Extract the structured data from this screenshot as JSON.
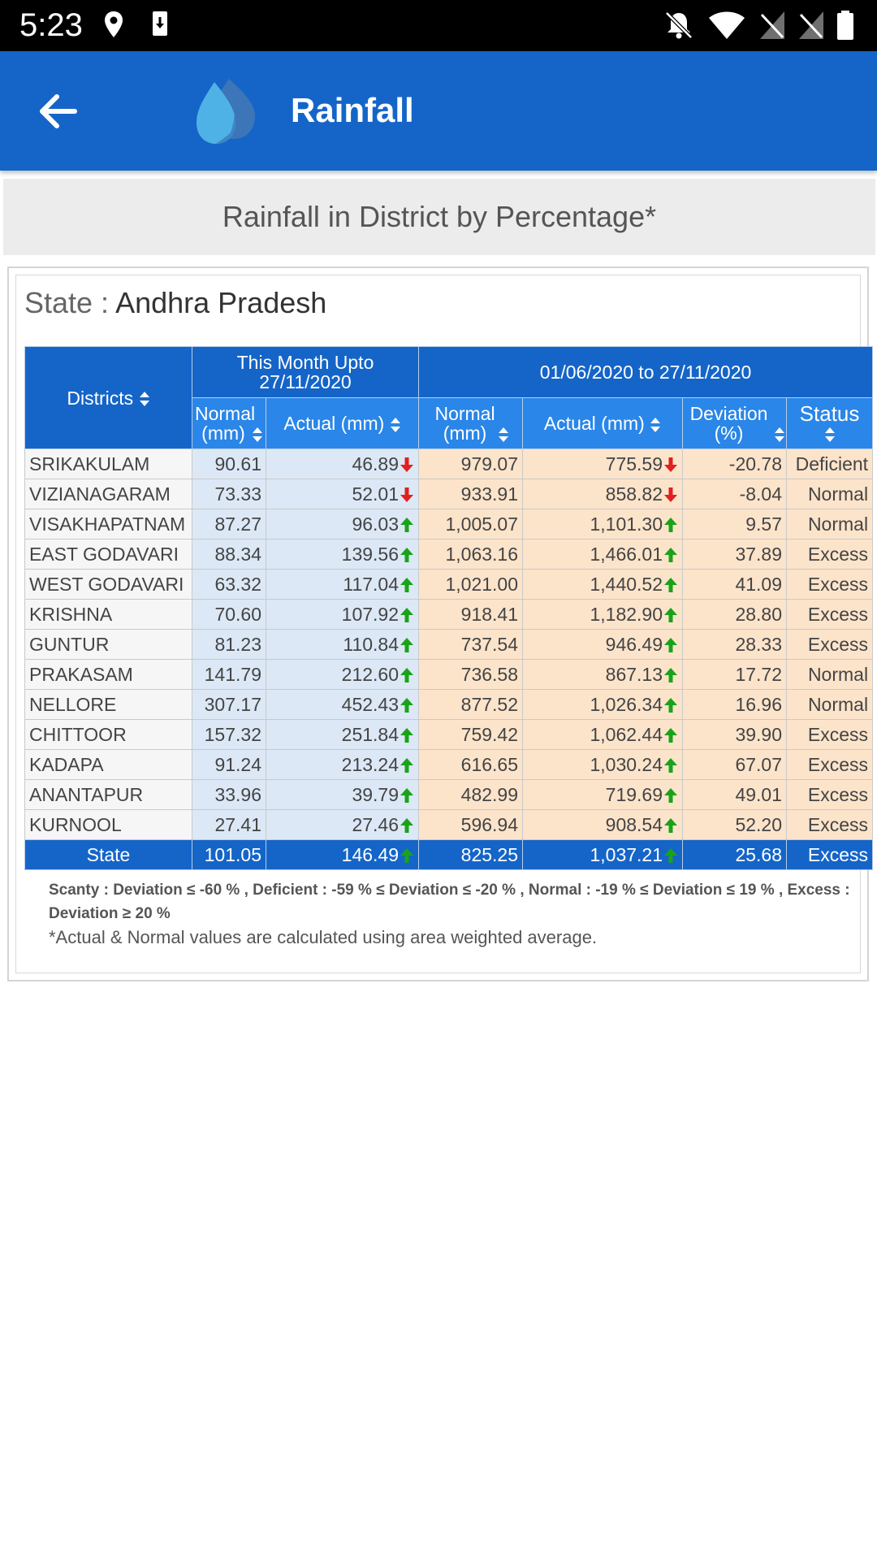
{
  "status_bar": {
    "time": "5:23"
  },
  "app_bar": {
    "title": "Rainfall"
  },
  "subheader": "Rainfall in District by Percentage*",
  "state": {
    "label": "State :",
    "value": "Andhra Pradesh"
  },
  "table": {
    "headers": {
      "districts": "Districts",
      "this_month": "This Month Upto 27/11/2020",
      "period": "01/06/2020 to 27/11/2020",
      "normal_mm": "Normal (mm)",
      "actual_mm": "Actual (mm)",
      "deviation": "Deviation (%)",
      "status": "Status"
    },
    "rows": [
      {
        "district": "SRIKAKULAM",
        "m_normal": "90.61",
        "m_actual": "46.89",
        "m_trend": "down",
        "p_normal": "979.07",
        "p_actual": "775.59",
        "p_trend": "down",
        "deviation": "-20.78",
        "status": "Deficient"
      },
      {
        "district": "VIZIANAGARAM",
        "m_normal": "73.33",
        "m_actual": "52.01",
        "m_trend": "down",
        "p_normal": "933.91",
        "p_actual": "858.82",
        "p_trend": "down",
        "deviation": "-8.04",
        "status": "Normal"
      },
      {
        "district": "VISAKHAPATNAM",
        "m_normal": "87.27",
        "m_actual": "96.03",
        "m_trend": "up",
        "p_normal": "1,005.07",
        "p_actual": "1,101.30",
        "p_trend": "up",
        "deviation": "9.57",
        "status": "Normal"
      },
      {
        "district": "EAST GODAVARI",
        "m_normal": "88.34",
        "m_actual": "139.56",
        "m_trend": "up",
        "p_normal": "1,063.16",
        "p_actual": "1,466.01",
        "p_trend": "up",
        "deviation": "37.89",
        "status": "Excess"
      },
      {
        "district": "WEST GODAVARI",
        "m_normal": "63.32",
        "m_actual": "117.04",
        "m_trend": "up",
        "p_normal": "1,021.00",
        "p_actual": "1,440.52",
        "p_trend": "up",
        "deviation": "41.09",
        "status": "Excess"
      },
      {
        "district": "KRISHNA",
        "m_normal": "70.60",
        "m_actual": "107.92",
        "m_trend": "up",
        "p_normal": "918.41",
        "p_actual": "1,182.90",
        "p_trend": "up",
        "deviation": "28.80",
        "status": "Excess"
      },
      {
        "district": "GUNTUR",
        "m_normal": "81.23",
        "m_actual": "110.84",
        "m_trend": "up",
        "p_normal": "737.54",
        "p_actual": "946.49",
        "p_trend": "up",
        "deviation": "28.33",
        "status": "Excess"
      },
      {
        "district": "PRAKASAM",
        "m_normal": "141.79",
        "m_actual": "212.60",
        "m_trend": "up",
        "p_normal": "736.58",
        "p_actual": "867.13",
        "p_trend": "up",
        "deviation": "17.72",
        "status": "Normal"
      },
      {
        "district": "NELLORE",
        "m_normal": "307.17",
        "m_actual": "452.43",
        "m_trend": "up",
        "p_normal": "877.52",
        "p_actual": "1,026.34",
        "p_trend": "up",
        "deviation": "16.96",
        "status": "Normal"
      },
      {
        "district": "CHITTOOR",
        "m_normal": "157.32",
        "m_actual": "251.84",
        "m_trend": "up",
        "p_normal": "759.42",
        "p_actual": "1,062.44",
        "p_trend": "up",
        "deviation": "39.90",
        "status": "Excess"
      },
      {
        "district": "KADAPA",
        "m_normal": "91.24",
        "m_actual": "213.24",
        "m_trend": "up",
        "p_normal": "616.65",
        "p_actual": "1,030.24",
        "p_trend": "up",
        "deviation": "67.07",
        "status": "Excess"
      },
      {
        "district": "ANANTAPUR",
        "m_normal": "33.96",
        "m_actual": "39.79",
        "m_trend": "up",
        "p_normal": "482.99",
        "p_actual": "719.69",
        "p_trend": "up",
        "deviation": "49.01",
        "status": "Excess"
      },
      {
        "district": "KURNOOL",
        "m_normal": "27.41",
        "m_actual": "27.46",
        "m_trend": "up",
        "p_normal": "596.94",
        "p_actual": "908.54",
        "p_trend": "up",
        "deviation": "52.20",
        "status": "Excess"
      }
    ],
    "total": {
      "district": "State",
      "m_normal": "101.05",
      "m_actual": "146.49",
      "m_trend": "up",
      "p_normal": "825.25",
      "p_actual": "1,037.21",
      "p_trend": "up",
      "deviation": "25.68",
      "status": "Excess"
    }
  },
  "legend": "Scanty : Deviation ≤ -60 % ,    Deficient : -59 % ≤ Deviation ≤ -20 % ,    Normal : -19 % ≤ Deviation ≤ 19 % ,    Excess : Deviation ≥ 20 %",
  "note": "*Actual & Normal values are calculated using area weighted average.",
  "colors": {
    "primary": "#1565c8",
    "header_sub": "#2a86e8",
    "month_cell": "#dce8f6",
    "period_cell": "#fce4cb",
    "trend_up": "#1aa31a",
    "trend_down": "#e02020"
  }
}
